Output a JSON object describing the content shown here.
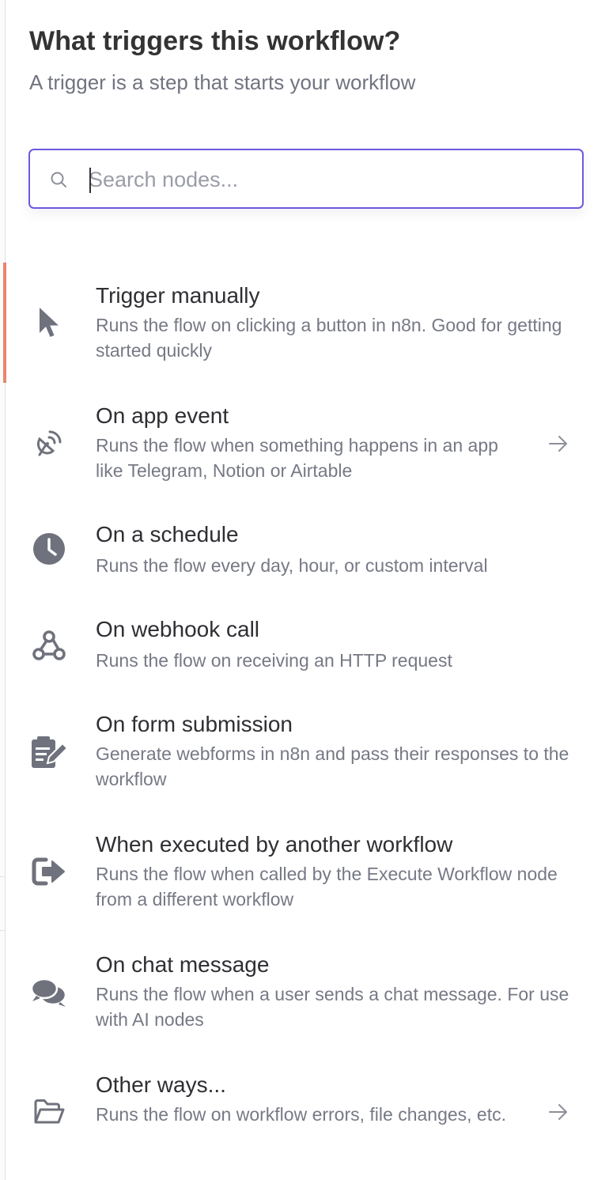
{
  "header": {
    "title": "What triggers this workflow?",
    "subtitle": "A trigger is a step that starts your workflow"
  },
  "search": {
    "placeholder": "Search nodes...",
    "value": "",
    "icon": "search-icon"
  },
  "triggers": [
    {
      "title": "Trigger manually",
      "description": "Runs the flow on clicking a button in n8n. Good for getting started quickly",
      "icon": "cursor-icon",
      "selected": true
    },
    {
      "title": "On app event",
      "description": "Runs the flow when something happens in an app like Telegram, Notion or Airtable",
      "icon": "satellite-dish-icon",
      "arrow": "arrow-right-icon"
    },
    {
      "title": "On a schedule",
      "description": "Runs the flow every day, hour, or custom interval",
      "icon": "clock-icon"
    },
    {
      "title": "On webhook call",
      "description": "Runs the flow on receiving an HTTP request",
      "icon": "webhook-icon"
    },
    {
      "title": "On form submission",
      "description": "Generate webforms in n8n and pass their responses to the workflow",
      "icon": "form-edit-icon"
    },
    {
      "title": "When executed by another workflow",
      "description": "Runs the flow when called by the Execute Workflow node from a different workflow",
      "icon": "sign-out-icon"
    },
    {
      "title": "On chat message",
      "description": "Runs the flow when a user sends a chat message. For use with AI nodes",
      "icon": "comments-icon"
    },
    {
      "title": "Other ways...",
      "description": "Runs the flow on workflow errors, file changes, etc.",
      "icon": "folder-open-icon",
      "arrow": "arrow-right-icon"
    }
  ],
  "colors": {
    "accent": "#6b5ae0",
    "selected_marker": "#e8866b",
    "title_text": "#333333",
    "muted_text": "#767985",
    "icon": "#6f727d"
  }
}
